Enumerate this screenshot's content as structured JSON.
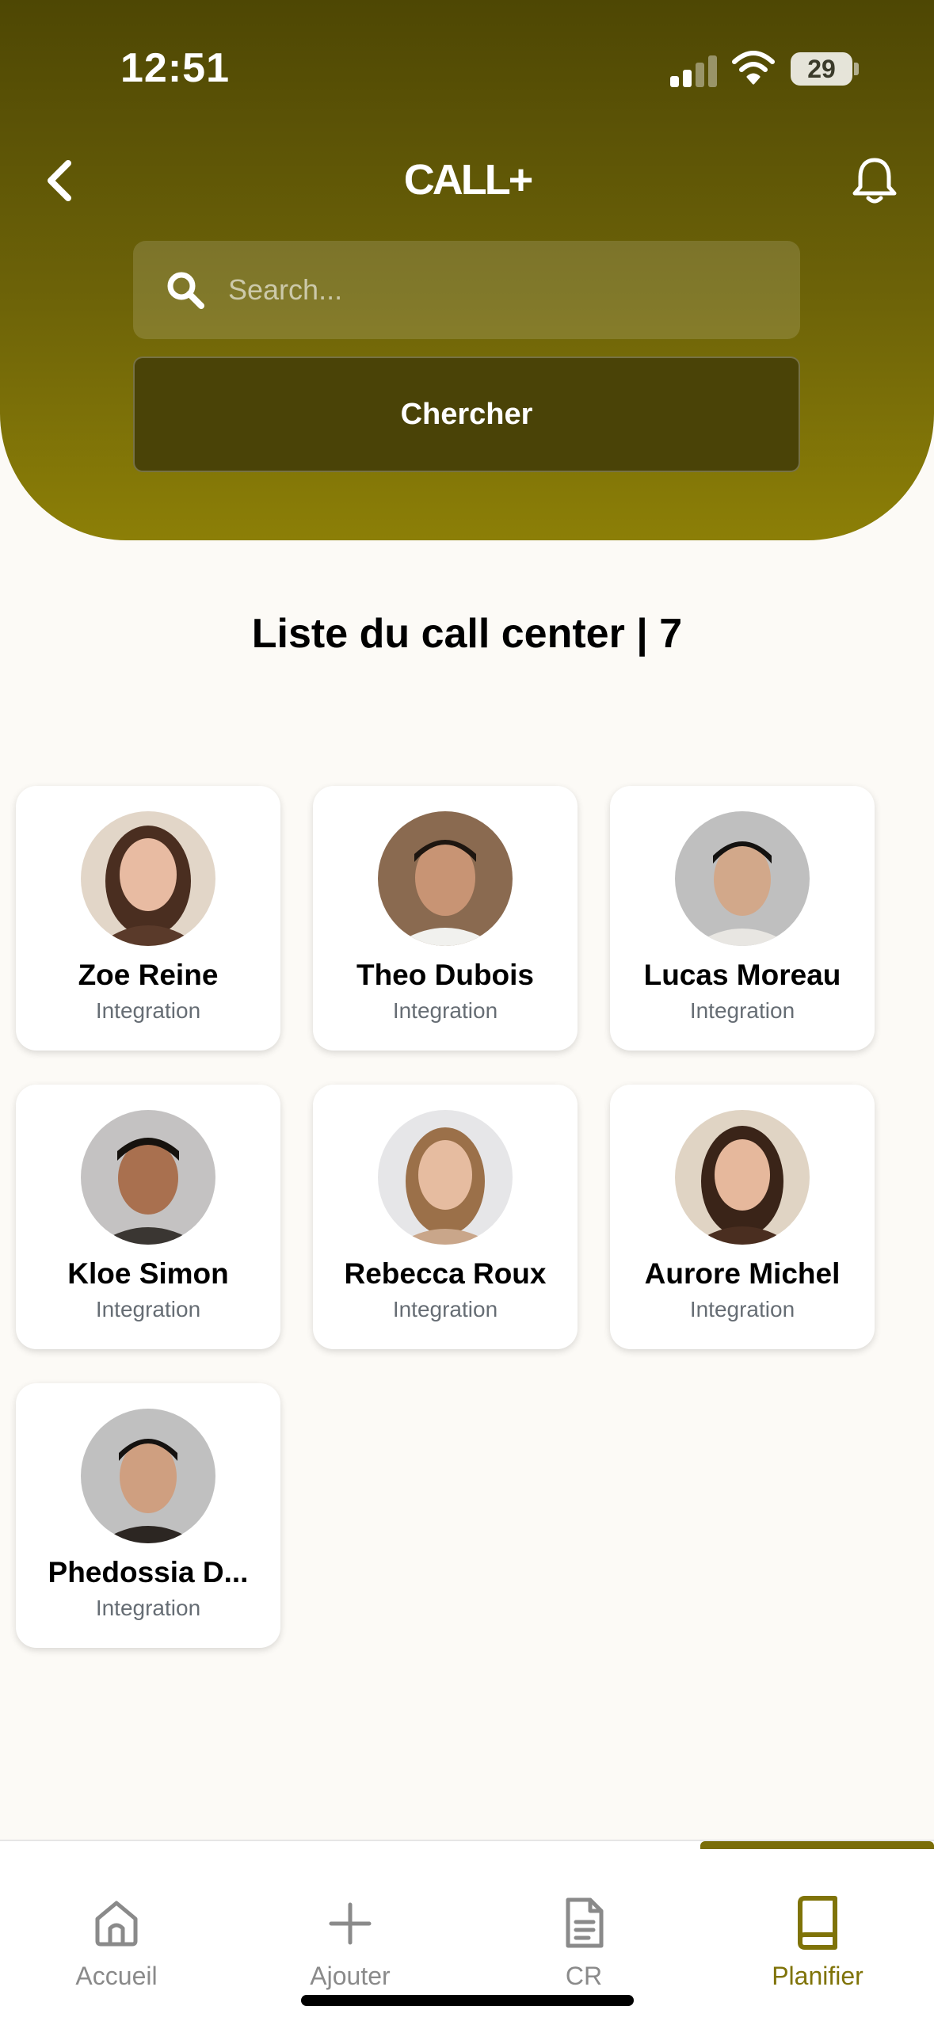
{
  "status_bar": {
    "time": "12:51",
    "battery": "29"
  },
  "header": {
    "title": "CALL+",
    "search_placeholder": "Search...",
    "search_button": "Chercher"
  },
  "section_title": "Liste du call center | 7",
  "agents": [
    {
      "name": "Zoe Reine",
      "role": "Integration"
    },
    {
      "name": "Theo Dubois",
      "role": "Integration"
    },
    {
      "name": "Lucas Moreau",
      "role": "Integration"
    },
    {
      "name": "Kloe Simon",
      "role": "Integration"
    },
    {
      "name": "Rebecca Roux",
      "role": "Integration"
    },
    {
      "name": "Aurore Michel",
      "role": "Integration"
    },
    {
      "name": "Phedossia D...",
      "role": "Integration"
    }
  ],
  "nav": [
    {
      "label": "Accueil",
      "icon": "home-icon"
    },
    {
      "label": "Ajouter",
      "icon": "plus-icon"
    },
    {
      "label": "CR",
      "icon": "document-icon"
    },
    {
      "label": "Planifier",
      "icon": "book-icon"
    }
  ],
  "colors": {
    "accent": "#7f7308",
    "header_dark": "#4e4704",
    "background": "#fcfaf6"
  }
}
